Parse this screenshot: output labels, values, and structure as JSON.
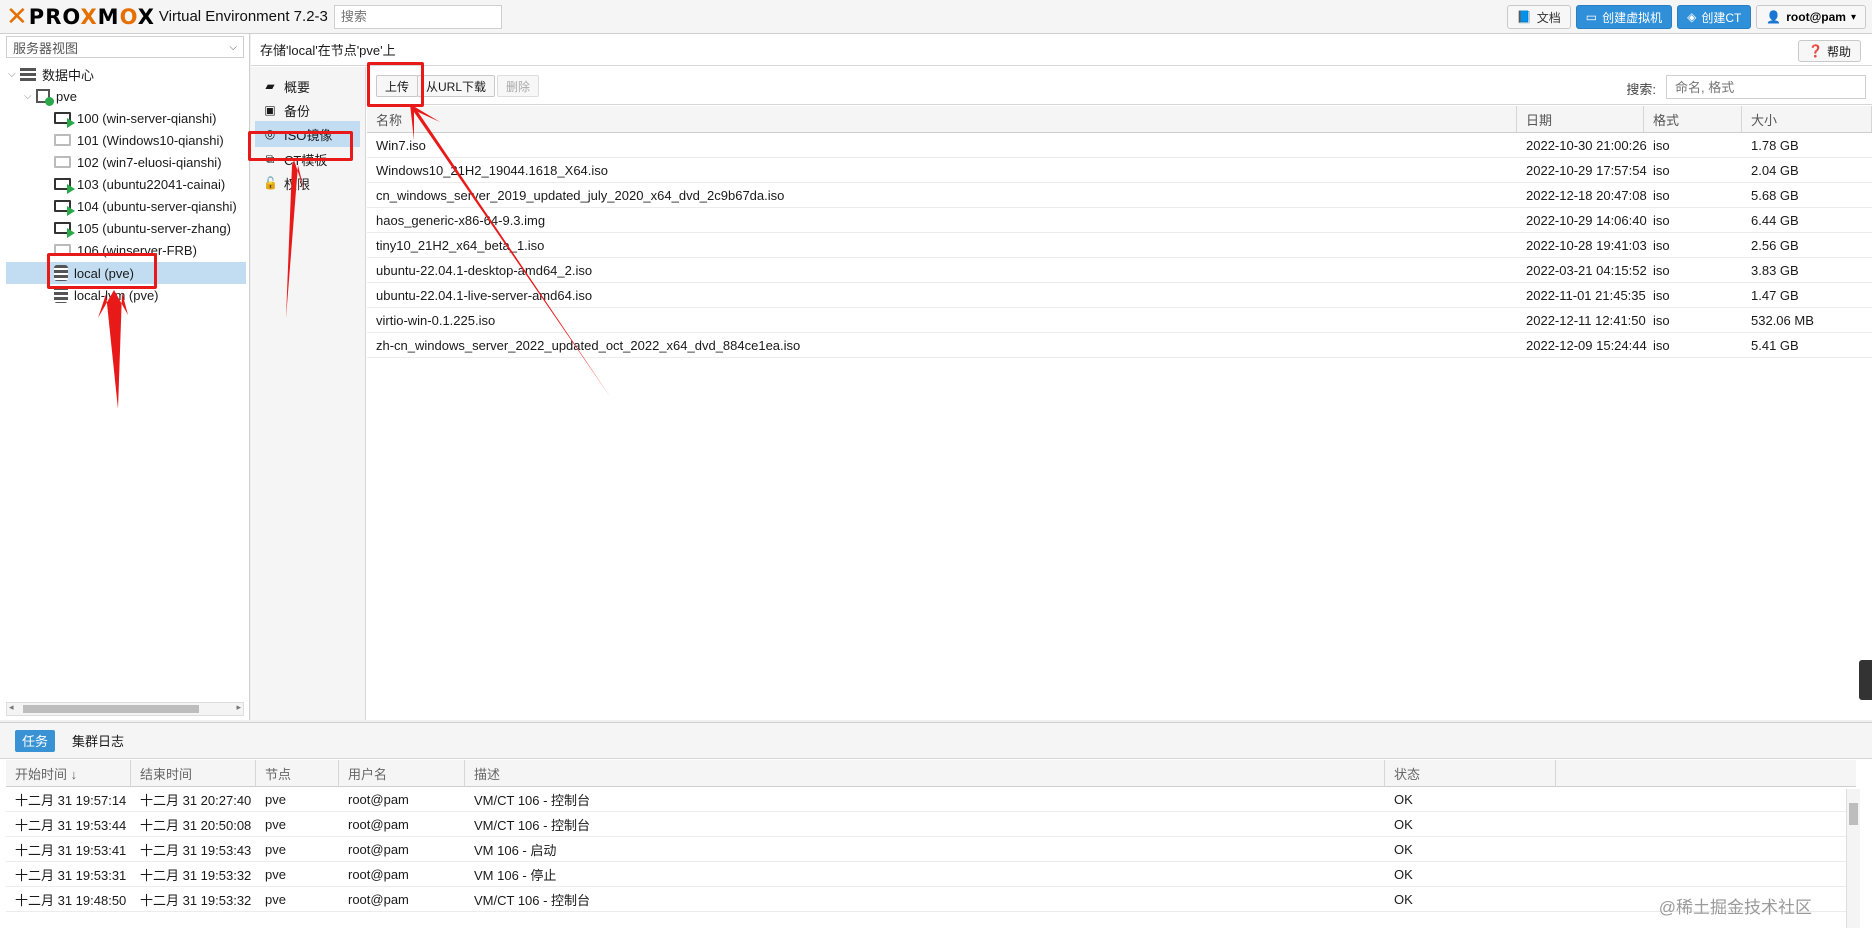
{
  "topbar": {
    "logo_text": "PROXMOX",
    "version": "Virtual Environment 7.2-3",
    "search_placeholder": "搜索",
    "buttons": {
      "docs": "文档",
      "create_vm": "创建虚拟机",
      "create_ct": "创建CT",
      "user": "root@pam"
    }
  },
  "tree": {
    "view_select": "服务器视图",
    "datacenter": "数据中心",
    "node": "pve",
    "vms": [
      {
        "label": "100 (win-server-qianshi)",
        "running": true
      },
      {
        "label": "101 (Windows10-qianshi)",
        "running": false
      },
      {
        "label": "102 (win7-eluosi-qianshi)",
        "running": false
      },
      {
        "label": "103 (ubuntu22041-cainai)",
        "running": true
      },
      {
        "label": "104 (ubuntu-server-qianshi)",
        "running": true
      },
      {
        "label": "105 (ubuntu-server-zhang)",
        "running": true
      },
      {
        "label": "106 (winserver-FRB)",
        "running": false
      }
    ],
    "storages": [
      "local (pve)",
      "local-lvm (pve)"
    ]
  },
  "content": {
    "header": "存储'local'在节点'pve'上",
    "help": "帮助",
    "nav": [
      "概要",
      "备份",
      "ISO镜像",
      "CT模板",
      "权限"
    ],
    "toolbar": {
      "upload": "上传",
      "download_url": "从URL下载",
      "delete": "删除",
      "search_label": "搜索:",
      "search_placeholder": "命名, 格式"
    },
    "columns": [
      "名称",
      "日期",
      "格式",
      "大小"
    ],
    "rows": [
      [
        "Win7.iso",
        "2022-10-30 21:00:26",
        "iso",
        "1.78 GB"
      ],
      [
        "Windows10_21H2_19044.1618_X64.iso",
        "2022-10-29 17:57:54",
        "iso",
        "2.04 GB"
      ],
      [
        "cn_windows_server_2019_updated_july_2020_x64_dvd_2c9b67da.iso",
        "2022-12-18 20:47:08",
        "iso",
        "5.68 GB"
      ],
      [
        "haos_generic-x86-64-9.3.img",
        "2022-10-29 14:06:40",
        "iso",
        "6.44 GB"
      ],
      [
        "tiny10_21H2_x64_beta_1.iso",
        "2022-10-28 19:41:03",
        "iso",
        "2.56 GB"
      ],
      [
        "ubuntu-22.04.1-desktop-amd64_2.iso",
        "2022-03-21 04:15:52",
        "iso",
        "3.83 GB"
      ],
      [
        "ubuntu-22.04.1-live-server-amd64.iso",
        "2022-11-01 21:45:35",
        "iso",
        "1.47 GB"
      ],
      [
        "virtio-win-0.1.225.iso",
        "2022-12-11 12:41:50",
        "iso",
        "532.06 MB"
      ],
      [
        "zh-cn_windows_server_2022_updated_oct_2022_x64_dvd_884ce1ea.iso",
        "2022-12-09 15:24:44",
        "iso",
        "5.41 GB"
      ]
    ]
  },
  "tasks": {
    "tabs": [
      "任务",
      "集群日志"
    ],
    "columns": [
      "开始时间 ↓",
      "结束时间",
      "节点",
      "用户名",
      "描述",
      "状态"
    ],
    "rows": [
      [
        "十二月 31 19:57:14",
        "十二月 31 20:27:40",
        "pve",
        "root@pam",
        "VM/CT 106 - 控制台",
        "OK"
      ],
      [
        "十二月 31 19:53:44",
        "十二月 31 20:50:08",
        "pve",
        "root@pam",
        "VM/CT 106 - 控制台",
        "OK"
      ],
      [
        "十二月 31 19:53:41",
        "十二月 31 19:53:43",
        "pve",
        "root@pam",
        "VM 106 - 启动",
        "OK"
      ],
      [
        "十二月 31 19:53:31",
        "十二月 31 19:53:32",
        "pve",
        "root@pam",
        "VM 106 - 停止",
        "OK"
      ],
      [
        "十二月 31 19:48:50",
        "十二月 31 19:53:32",
        "pve",
        "root@pam",
        "VM/CT 106 - 控制台",
        "OK"
      ]
    ]
  },
  "watermark": "@稀土掘金技术社区",
  "colors": {
    "accent": "#e57000",
    "selection": "#c2ddf2",
    "button_blue": "#2f8fd8",
    "annotation": "#e81919"
  },
  "icons": [
    "search-icon",
    "book-icon",
    "monitor-icon",
    "cube-icon",
    "user-icon",
    "question-icon",
    "server-icon",
    "storage-icon",
    "disc-icon",
    "lock-icon",
    "floppy-icon"
  ]
}
